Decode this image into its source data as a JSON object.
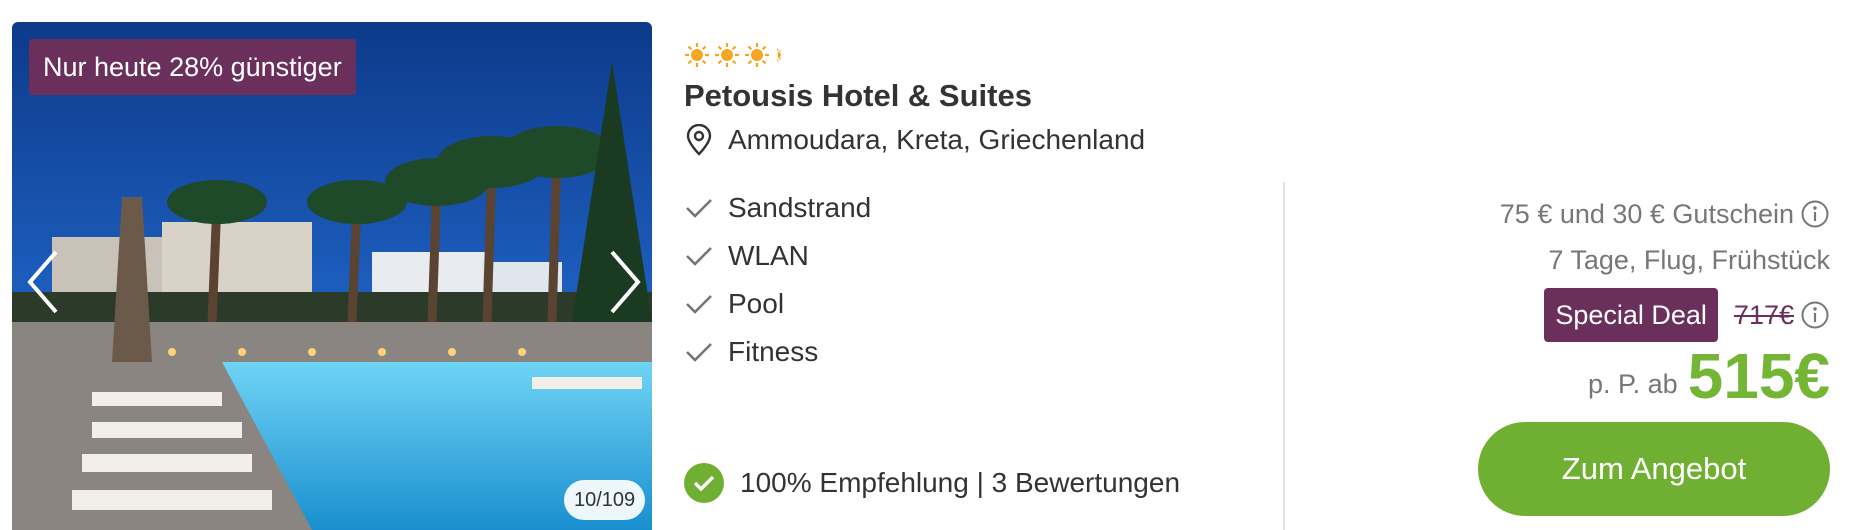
{
  "gallery": {
    "discount_badge": "Nur heute 28% günstiger",
    "counter": "10/109",
    "prev_icon": "chevron-left-icon",
    "next_icon": "chevron-right-icon"
  },
  "hotel": {
    "stars": 3.5,
    "star_icon": "sun-icon",
    "name": "Petousis Hotel & Suites",
    "location": "Ammoudara, Kreta, Griechenland",
    "location_icon": "map-pin-icon",
    "features": [
      "Sandstrand",
      "WLAN",
      "Pool",
      "Fitness"
    ],
    "feature_icon": "check-icon",
    "rating": "100% Empfehlung | 3 Bewertungen",
    "rating_icon": "check-circle-icon"
  },
  "offer": {
    "voucher": "75 € und 30 € Gutschein",
    "package": "7 Tage, Flug, Frühstück",
    "special_deal": "Special Deal",
    "old_price": "717€",
    "price_prefix": "p. P. ab",
    "price": "515€",
    "cta_label": "Zum Angebot"
  },
  "colors": {
    "brand_purple": "#6b2f5c",
    "price_green": "#75b535",
    "cta_green": "#6fb033",
    "star_orange": "#f5a623"
  }
}
